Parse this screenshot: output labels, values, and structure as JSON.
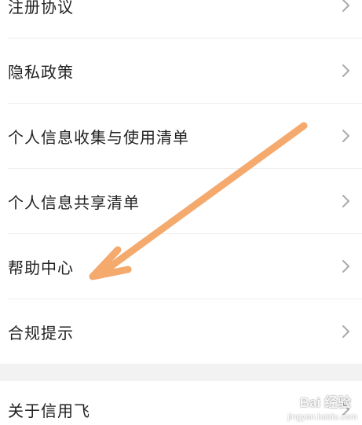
{
  "menu": {
    "items": [
      {
        "label": "注册协议",
        "icon": "chevron-right-icon"
      },
      {
        "label": "隐私政策",
        "icon": "chevron-right-icon"
      },
      {
        "label": "个人信息收集与使用清单",
        "icon": "chevron-right-icon"
      },
      {
        "label": "个人信息共享清单",
        "icon": "chevron-right-icon"
      },
      {
        "label": "帮助中心",
        "icon": "chevron-right-icon"
      },
      {
        "label": "合规提示",
        "icon": "chevron-right-icon"
      }
    ],
    "about": {
      "label": "关于信用飞",
      "icon": "chevron-right-icon"
    }
  },
  "annotation": {
    "arrow_color": "#f4a261",
    "points_to": "帮助中心"
  },
  "watermark": {
    "text": "Bai 经验",
    "sub": "jingyan.baidu.com"
  }
}
